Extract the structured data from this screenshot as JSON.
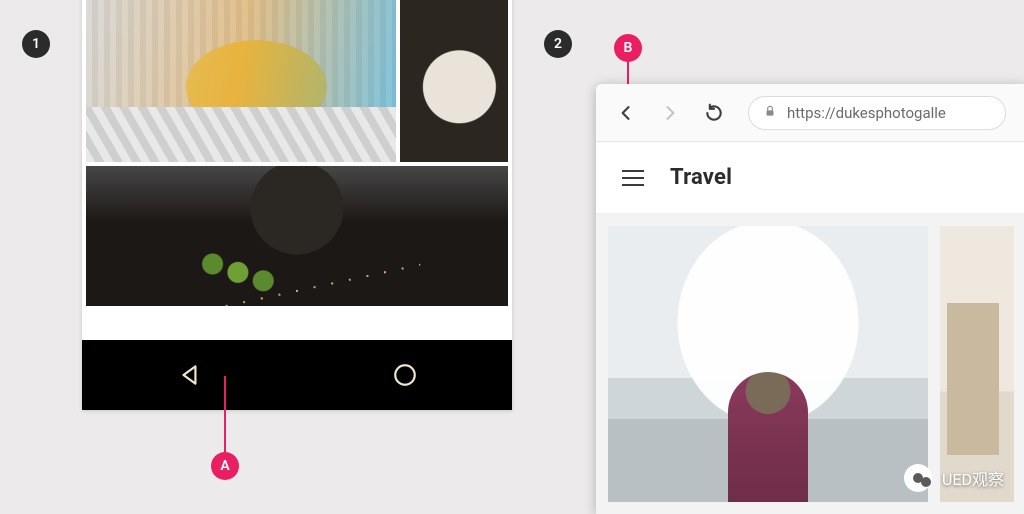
{
  "annotations": {
    "badge1": "1",
    "badge2": "2",
    "calloutA": "A",
    "calloutB": "B"
  },
  "browser": {
    "url": "https://dukesphotogalle",
    "app_title": "Travel"
  },
  "watermark": {
    "label": "UED观察"
  }
}
